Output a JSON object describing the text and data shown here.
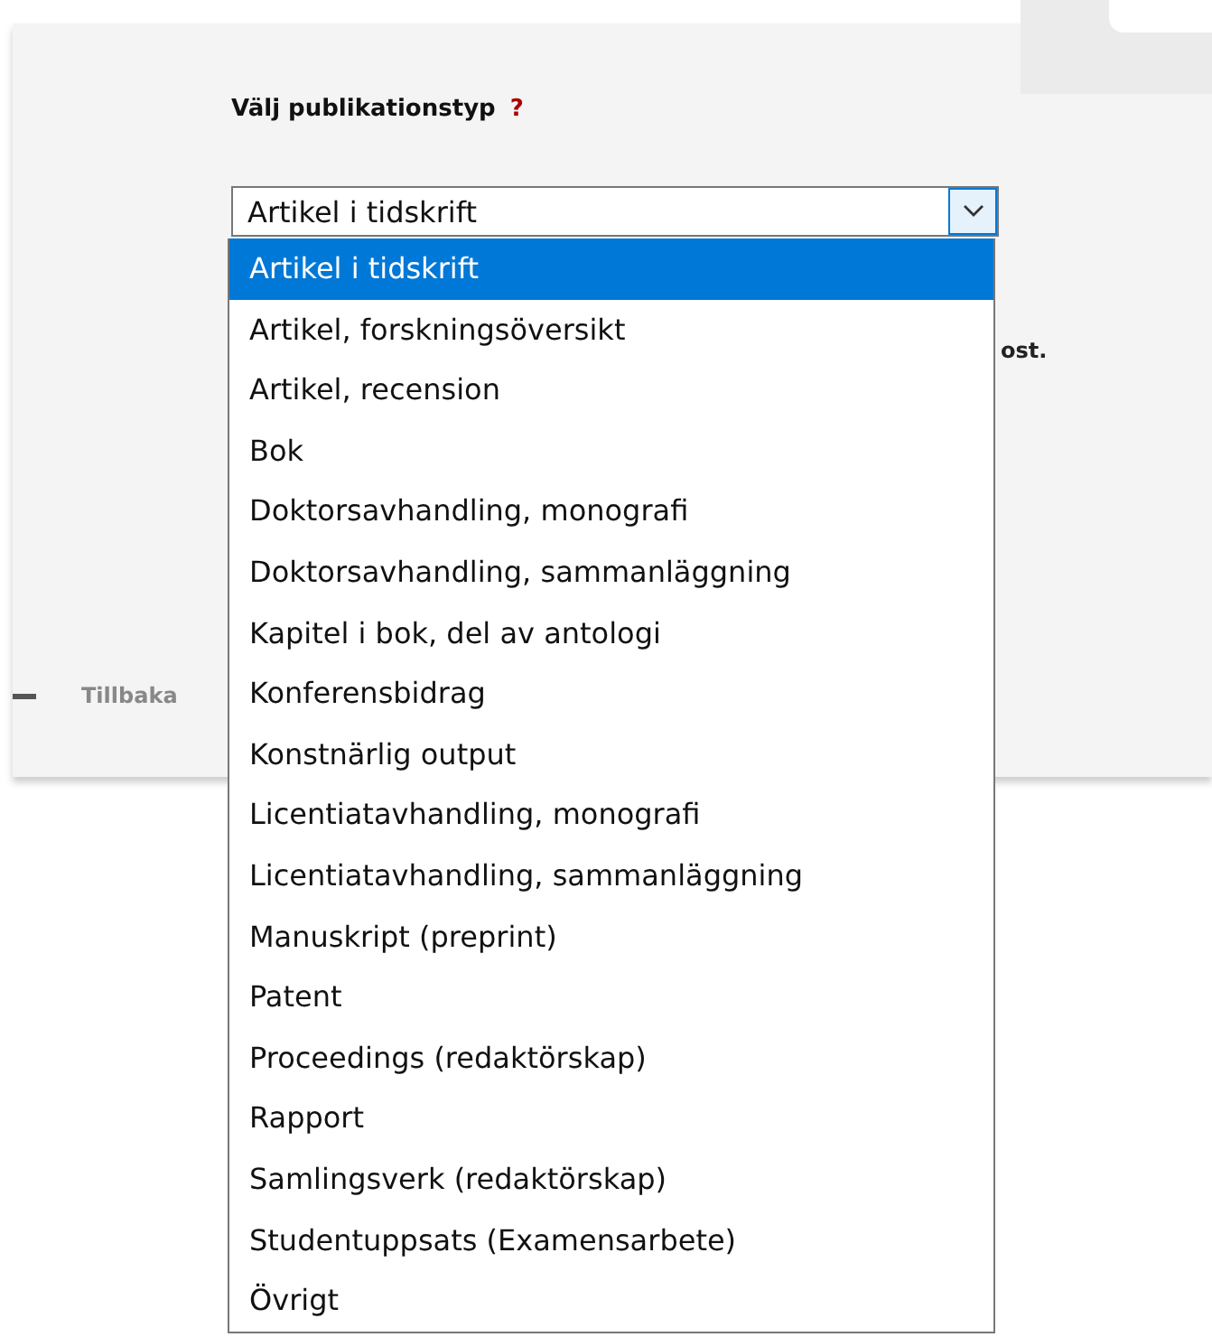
{
  "field": {
    "label": "Välj publikationstyp",
    "help": "?",
    "value": "Artikel i tidskrift"
  },
  "hidden_text": "ost.",
  "back_link": "Tillbaka",
  "options": [
    {
      "label": "Artikel i tidskrift",
      "selected": true
    },
    {
      "label": "Artikel, forskningsöversikt",
      "selected": false
    },
    {
      "label": "Artikel, recension",
      "selected": false
    },
    {
      "label": "Bok",
      "selected": false
    },
    {
      "label": "Doktorsavhandling, monografi",
      "selected": false
    },
    {
      "label": "Doktorsavhandling, sammanläggning",
      "selected": false
    },
    {
      "label": "Kapitel i bok, del av antologi",
      "selected": false
    },
    {
      "label": "Konferensbidrag",
      "selected": false
    },
    {
      "label": "Konstnärlig output",
      "selected": false
    },
    {
      "label": "Licentiatavhandling, monografi",
      "selected": false
    },
    {
      "label": "Licentiatavhandling, sammanläggning",
      "selected": false
    },
    {
      "label": "Manuskript (preprint)",
      "selected": false
    },
    {
      "label": "Patent",
      "selected": false
    },
    {
      "label": "Proceedings (redaktörskap)",
      "selected": false
    },
    {
      "label": "Rapport",
      "selected": false
    },
    {
      "label": "Samlingsverk (redaktörskap)",
      "selected": false
    },
    {
      "label": "Studentuppsats (Examensarbete)",
      "selected": false
    },
    {
      "label": "Övrigt",
      "selected": false
    }
  ]
}
